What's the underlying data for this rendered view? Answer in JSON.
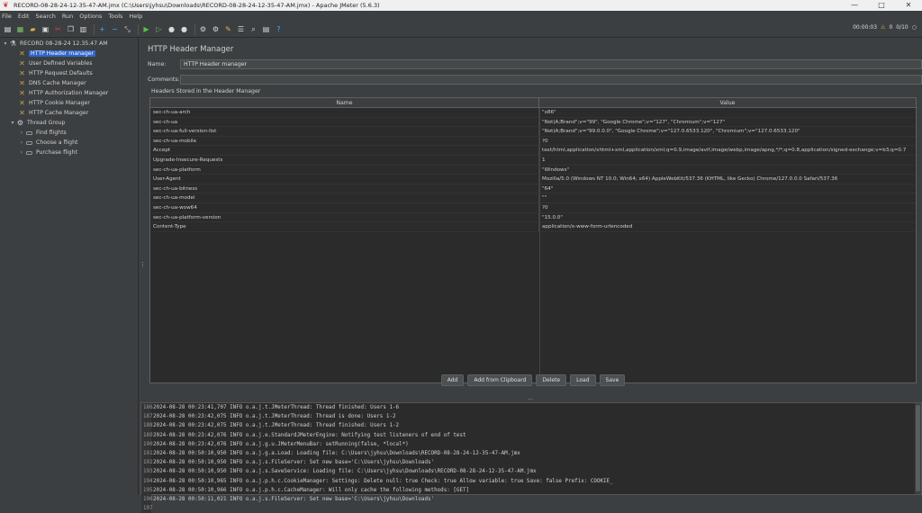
{
  "window": {
    "title": "RECORD-08-28-24-12-35-47-AM.jmx (C:\\Users\\jyhsu\\Downloads\\RECORD-08-28-24-12-35-47-AM.jmx) - Apache JMeter (5.6.3)",
    "minimize": "—",
    "maximize": "□",
    "close": "✕"
  },
  "menu": [
    "File",
    "Edit",
    "Search",
    "Run",
    "Options",
    "Tools",
    "Help"
  ],
  "toolbar": {
    "timer": "00:00:03",
    "warnings": "0",
    "threads": "0/10"
  },
  "tree": {
    "root": "RECORD 08-28-24 12.35.47 AM",
    "items": [
      {
        "label": "HTTP Header manager",
        "selected": true
      },
      {
        "label": "User Defined Variables"
      },
      {
        "label": "HTTP Request Defaults"
      },
      {
        "label": "DNS Cache Manager"
      },
      {
        "label": "HTTP Authorization Manager"
      },
      {
        "label": "HTTP Cookie Manager"
      },
      {
        "label": "HTTP Cache Manager"
      }
    ],
    "thread_group": "Thread Group",
    "children": [
      "Find flights",
      "Choose a flight",
      "Purchase flight"
    ]
  },
  "panel": {
    "title": "HTTP Header Manager",
    "name_label": "Name:",
    "name_value": "HTTP Header manager",
    "comments_label": "Comments:",
    "comments_value": "",
    "group_label": "Headers Stored in the Header Manager"
  },
  "table": {
    "headers": [
      "Name",
      "Value"
    ],
    "rows": [
      [
        "sec-ch-ua-arch",
        "\"x86\""
      ],
      [
        "sec-ch-ua",
        "\"Not)A;Brand\";v=\"99\", \"Google Chrome\";v=\"127\", \"Chromium\";v=\"127\""
      ],
      [
        "sec-ch-ua-full-version-list",
        "\"Not)A;Brand\";v=\"99.0.0.0\", \"Google Chrome\";v=\"127.0.6533.120\", \"Chromium\";v=\"127.0.6533.120\""
      ],
      [
        "sec-ch-ua-mobile",
        "?0"
      ],
      [
        "Accept",
        "text/html,application/xhtml+xml,application/xml;q=0.9,image/avif,image/webp,image/apng,*/*;q=0.8,application/signed-exchange;v=b3;q=0.7"
      ],
      [
        "Upgrade-Insecure-Requests",
        "1"
      ],
      [
        "sec-ch-ua-platform",
        "\"Windows\""
      ],
      [
        "User-Agent",
        "Mozilla/5.0 (Windows NT 10.0; Win64; x64) AppleWebKit/537.36 (KHTML, like Gecko) Chrome/127.0.0.0 Safari/537.36"
      ],
      [
        "sec-ch-ua-bitness",
        "\"64\""
      ],
      [
        "sec-ch-ua-model",
        "\"\""
      ],
      [
        "sec-ch-ua-wow64",
        "?0"
      ],
      [
        "sec-ch-ua-platform-version",
        "\"15.0.0\""
      ],
      [
        "Content-Type",
        "application/x-www-form-urlencoded"
      ]
    ]
  },
  "buttons": [
    "Add",
    "Add from Clipboard",
    "Delete",
    "Load",
    "Save"
  ],
  "log": [
    {
      "n": "186",
      "text": "2024-08-28 00:23:41,707 INFO o.a.j.t.JMeterThread: Thread finished: Users 1-6"
    },
    {
      "n": "187",
      "text": "2024-08-28 00:23:42,075 INFO o.a.j.t.JMeterThread: Thread is done: Users 1-2"
    },
    {
      "n": "188",
      "text": "2024-08-28 00:23:42,075 INFO o.a.j.t.JMeterThread: Thread finished: Users 1-2"
    },
    {
      "n": "189",
      "text": "2024-08-28 00:23:42,076 INFO o.a.j.e.StandardJMeterEngine: Notifying test listeners of end of test"
    },
    {
      "n": "190",
      "text": "2024-08-28 00:23:42,076 INFO o.a.j.g.u.JMeterMenuBar: setRunning(false, *local*)"
    },
    {
      "n": "191",
      "text": "2024-08-28 00:50:10,950 INFO o.a.j.g.a.Load: Loading file: C:\\Users\\jyhsu\\Downloads\\RECORD-08-28-24-12-35-47-AM.jmx"
    },
    {
      "n": "192",
      "text": "2024-08-28 00:50:10,950 INFO o.a.j.s.FileServer: Set new base='C:\\Users\\jyhsu\\Downloads'"
    },
    {
      "n": "193",
      "text": "2024-08-28 00:50:10,950 INFO o.a.j.s.SaveService: Loading file: C:\\Users\\jyhsu\\Downloads\\RECORD-08-28-24-12-35-47-AM.jmx"
    },
    {
      "n": "194",
      "text": "2024-08-28 00:50:10,965 INFO o.a.j.p.h.c.CookieManager: Settings: Delete null: true Check: true Allow variable: true Save: false Prefix: COOKIE_"
    },
    {
      "n": "195",
      "text": "2024-08-28 00:50:10,966 INFO o.a.j.p.h.c.CacheManager: Will only cache the following methods: [GET]"
    },
    {
      "n": "196",
      "text": "2024-08-28 00:50:11,021 INFO o.a.j.s.FileServer: Set new base='C:\\Users\\jyhsu\\Downloads'"
    },
    {
      "n": "197",
      "text": ""
    }
  ]
}
